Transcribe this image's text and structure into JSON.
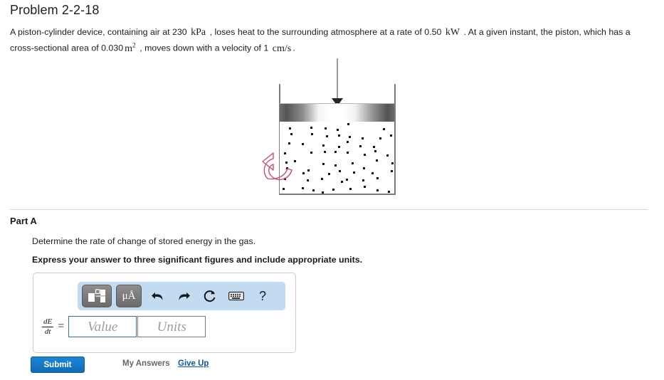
{
  "problem": {
    "title": "Problem 2-2-18",
    "statement": {
      "seg1": "A piston-cylinder device, containing air at 230",
      "unit1": "kPa",
      "seg2": ", loses heat to the surrounding atmosphere at a rate of 0.50",
      "unit2": "kW",
      "seg3": ". At a given instant, the piston, which has a cross-sectional area of 0.030",
      "unit3": "m",
      "unit3_sup": "2",
      "seg4": ", moves down with a velocity of 1",
      "unit4": "cm/s",
      "seg5": "."
    }
  },
  "figure": {
    "alt": "piston-cylinder device with gas dots, downward force arrow, and curved heat-loss arrow",
    "force_arrow": "downward-force-arrow",
    "heat_arrow": "heat-loss-arrow",
    "heat_arrow_color": "#d14a72",
    "piston_label": "piston-band",
    "gas_label": "gas-region",
    "cylinder_label": "cylinder-walls"
  },
  "part": {
    "label": "Part A",
    "question": "Determine the rate of change of stored energy in the gas.",
    "emphasis": "Express your answer to three significant figures and include appropriate units."
  },
  "answer": {
    "toolbar": {
      "template_button": "template-icon",
      "units_button": "μÅ",
      "undo": "↶",
      "redo": "↷",
      "reset": "⟳",
      "keyboard": "keyboard-icon",
      "help": "?"
    },
    "variable": {
      "numerator": "dE",
      "denominator": "dt",
      "equals": "="
    },
    "value_field": {
      "placeholder": "Value",
      "value": ""
    },
    "units_field": {
      "placeholder": "Units",
      "value": ""
    }
  },
  "actions": {
    "submit": "Submit",
    "my_answers": "My Answers",
    "give_up": "Give Up"
  },
  "colors": {
    "submit_blue": "#1175c9",
    "link_blue": "#1155a8",
    "toolbar_blue": "#c3dbf0",
    "heat_pink": "#d14a72",
    "field_border_active": "#3a6fb0"
  }
}
